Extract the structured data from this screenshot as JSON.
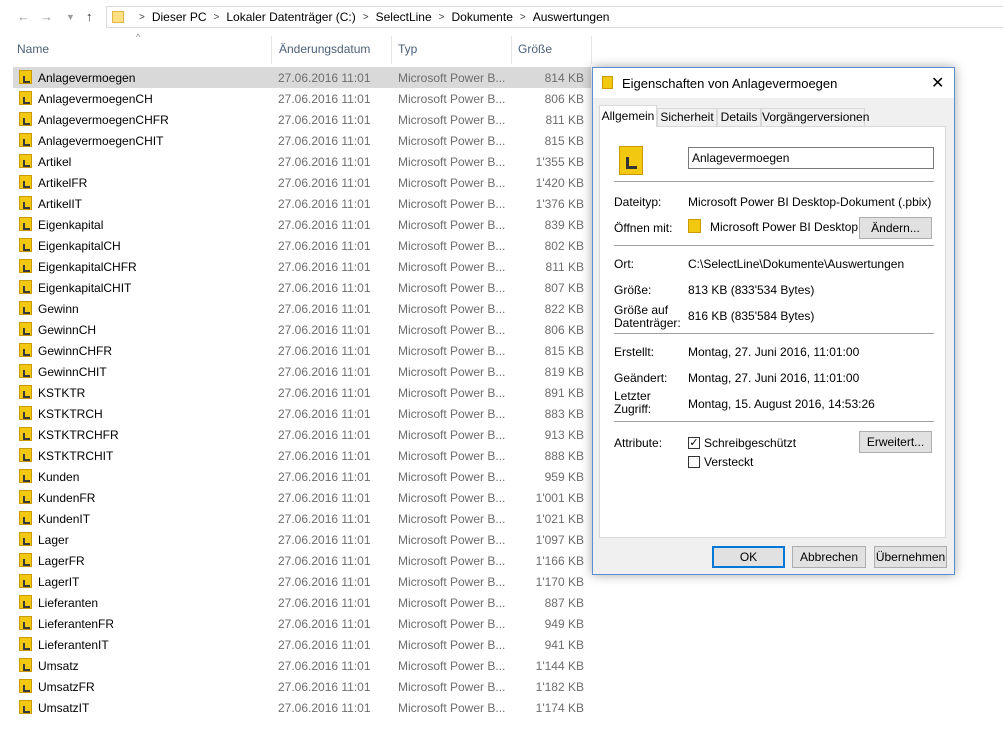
{
  "address": {
    "crumbs": [
      "Dieser PC",
      "Lokaler Datenträger (C:)",
      "SelectLine",
      "Dokumente",
      "Auswertungen"
    ]
  },
  "columns": {
    "name": "Name",
    "date": "Änderungsdatum",
    "type": "Typ",
    "size": "Größe"
  },
  "files": [
    {
      "name": "Anlagevermoegen",
      "date": "27.06.2016 11:01",
      "type": "Microsoft Power B...",
      "size": "814 KB"
    },
    {
      "name": "AnlagevermoegenCH",
      "date": "27.06.2016 11:01",
      "type": "Microsoft Power B...",
      "size": "806 KB"
    },
    {
      "name": "AnlagevermoegenCHFR",
      "date": "27.06.2016 11:01",
      "type": "Microsoft Power B...",
      "size": "811 KB"
    },
    {
      "name": "AnlagevermoegenCHIT",
      "date": "27.06.2016 11:01",
      "type": "Microsoft Power B...",
      "size": "815 KB"
    },
    {
      "name": "Artikel",
      "date": "27.06.2016 11:01",
      "type": "Microsoft Power B...",
      "size": "1'355 KB"
    },
    {
      "name": "ArtikelFR",
      "date": "27.06.2016 11:01",
      "type": "Microsoft Power B...",
      "size": "1'420 KB"
    },
    {
      "name": "ArtikelIT",
      "date": "27.06.2016 11:01",
      "type": "Microsoft Power B...",
      "size": "1'376 KB"
    },
    {
      "name": "Eigenkapital",
      "date": "27.06.2016 11:01",
      "type": "Microsoft Power B...",
      "size": "839 KB"
    },
    {
      "name": "EigenkapitalCH",
      "date": "27.06.2016 11:01",
      "type": "Microsoft Power B...",
      "size": "802 KB"
    },
    {
      "name": "EigenkapitalCHFR",
      "date": "27.06.2016 11:01",
      "type": "Microsoft Power B...",
      "size": "811 KB"
    },
    {
      "name": "EigenkapitalCHIT",
      "date": "27.06.2016 11:01",
      "type": "Microsoft Power B...",
      "size": "807 KB"
    },
    {
      "name": "Gewinn",
      "date": "27.06.2016 11:01",
      "type": "Microsoft Power B...",
      "size": "822 KB"
    },
    {
      "name": "GewinnCH",
      "date": "27.06.2016 11:01",
      "type": "Microsoft Power B...",
      "size": "806 KB"
    },
    {
      "name": "GewinnCHFR",
      "date": "27.06.2016 11:01",
      "type": "Microsoft Power B...",
      "size": "815 KB"
    },
    {
      "name": "GewinnCHIT",
      "date": "27.06.2016 11:01",
      "type": "Microsoft Power B...",
      "size": "819 KB"
    },
    {
      "name": "KSTKTR",
      "date": "27.06.2016 11:01",
      "type": "Microsoft Power B...",
      "size": "891 KB"
    },
    {
      "name": "KSTKTRCH",
      "date": "27.06.2016 11:01",
      "type": "Microsoft Power B...",
      "size": "883 KB"
    },
    {
      "name": "KSTKTRCHFR",
      "date": "27.06.2016 11:01",
      "type": "Microsoft Power B...",
      "size": "913 KB"
    },
    {
      "name": "KSTKTRCHIT",
      "date": "27.06.2016 11:01",
      "type": "Microsoft Power B...",
      "size": "888 KB"
    },
    {
      "name": "Kunden",
      "date": "27.06.2016 11:01",
      "type": "Microsoft Power B...",
      "size": "959 KB"
    },
    {
      "name": "KundenFR",
      "date": "27.06.2016 11:01",
      "type": "Microsoft Power B...",
      "size": "1'001 KB"
    },
    {
      "name": "KundenIT",
      "date": "27.06.2016 11:01",
      "type": "Microsoft Power B...",
      "size": "1'021 KB"
    },
    {
      "name": "Lager",
      "date": "27.06.2016 11:01",
      "type": "Microsoft Power B...",
      "size": "1'097 KB"
    },
    {
      "name": "LagerFR",
      "date": "27.06.2016 11:01",
      "type": "Microsoft Power B...",
      "size": "1'166 KB"
    },
    {
      "name": "LagerIT",
      "date": "27.06.2016 11:01",
      "type": "Microsoft Power B...",
      "size": "1'170 KB"
    },
    {
      "name": "Lieferanten",
      "date": "27.06.2016 11:01",
      "type": "Microsoft Power B...",
      "size": "887 KB"
    },
    {
      "name": "LieferantenFR",
      "date": "27.06.2016 11:01",
      "type": "Microsoft Power B...",
      "size": "949 KB"
    },
    {
      "name": "LieferantenIT",
      "date": "27.06.2016 11:01",
      "type": "Microsoft Power B...",
      "size": "941 KB"
    },
    {
      "name": "Umsatz",
      "date": "27.06.2016 11:01",
      "type": "Microsoft Power B...",
      "size": "1'144 KB"
    },
    {
      "name": "UmsatzFR",
      "date": "27.06.2016 11:01",
      "type": "Microsoft Power B...",
      "size": "1'182 KB"
    },
    {
      "name": "UmsatzIT",
      "date": "27.06.2016 11:01",
      "type": "Microsoft Power B...",
      "size": "1'174 KB"
    }
  ],
  "selected_index": 0,
  "dialog": {
    "title": "Eigenschaften von Anlagevermoegen",
    "tabs": [
      "Allgemein",
      "Sicherheit",
      "Details",
      "Vorgängerversionen"
    ],
    "active_tab": "Allgemein",
    "file_name": "Anlagevermoegen",
    "dateityp_label": "Dateityp:",
    "dateityp_value": "Microsoft Power BI Desktop-Dokument (.pbix)",
    "oeffnen_label": "Öffnen mit:",
    "oeffnen_value": "Microsoft Power BI Desktop",
    "aendern_button": "Ändern...",
    "ort_label": "Ort:",
    "ort_value": "C:\\SelectLine\\Dokumente\\Auswertungen",
    "groesse_label": "Größe:",
    "groesse_value": "813 KB (833'534 Bytes)",
    "groesse_dt_label_1": "Größe auf",
    "groesse_dt_label_2": "Datenträger:",
    "groesse_dt_value": "816 KB (835'584 Bytes)",
    "erstellt_label": "Erstellt:",
    "erstellt_value": "Montag, 27. Juni 2016, 11:01:00",
    "geaendert_label": "Geändert:",
    "geaendert_value": "Montag, 27. Juni 2016, 11:01:00",
    "zugriff_label_1": "Letzter",
    "zugriff_label_2": "Zugriff:",
    "zugriff_value": "Montag, 15. August 2016, 14:53:26",
    "attribute_label": "Attribute:",
    "readonly_label": "Schreibgeschützt",
    "readonly_checked": true,
    "hidden_label": "Versteckt",
    "hidden_checked": false,
    "erweitert_button": "Erweitert...",
    "ok_button": "OK",
    "abbrechen_button": "Abbrechen",
    "uebernehmen_button": "Übernehmen"
  },
  "colors": {
    "accent": "#0078d7",
    "selection": "#d9d9d9",
    "pbi_yellow": "#f2c811",
    "header_text": "#4c607a"
  },
  "icons": {
    "back": "arrow-left-icon",
    "forward": "arrow-right-icon",
    "recent": "chevron-down-icon",
    "up": "arrow-up-icon",
    "close": "close-icon"
  }
}
